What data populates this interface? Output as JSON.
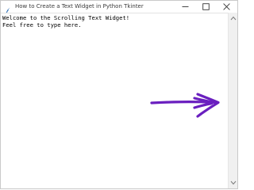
{
  "window": {
    "title": "How to Create a Text Widget in Python Tkinter"
  },
  "text_widget": {
    "lines": [
      "Welcome to the Scrolling Text Widget!",
      "Feel free to type here."
    ]
  },
  "icons": {
    "app": "feather-icon",
    "minimize": "minimize-icon",
    "maximize": "maximize-icon",
    "close": "close-icon",
    "scroll_up": "arrow-up-icon",
    "scroll_down": "arrow-down-icon",
    "annotation": "hand-drawn-arrow-icon"
  },
  "colors": {
    "annotation": "#6a1fbf",
    "text": "#000000",
    "title_text": "#3a3a3a",
    "scrollbar": "#f0f0f0"
  }
}
